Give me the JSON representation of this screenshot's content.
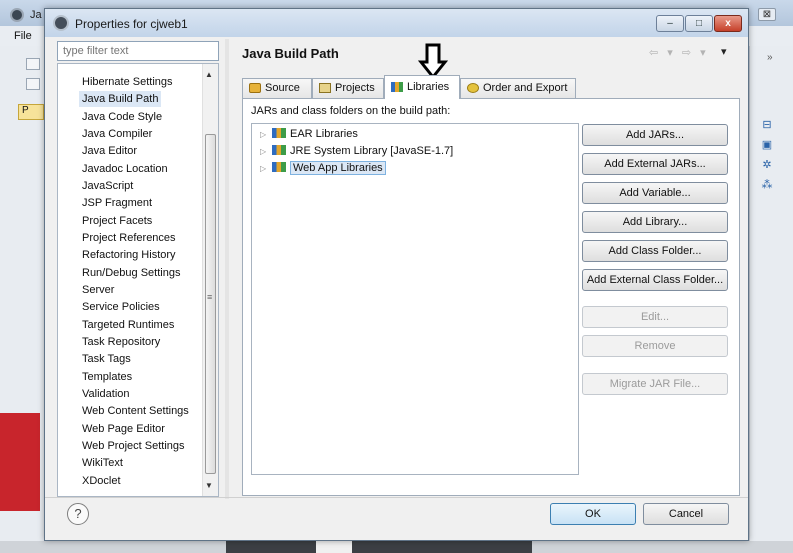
{
  "background": {
    "title_fragment": "Ja",
    "menu_file": "File",
    "package_explorer_tab": "P",
    "close_glyph": "⊠",
    "chevron": "»"
  },
  "dialog": {
    "title": "Properties for cjweb1",
    "filter_placeholder": "type filter text",
    "categories": [
      "Hibernate Settings",
      "Java Build Path",
      "Java Code Style",
      "Java Compiler",
      "Java Editor",
      "Javadoc Location",
      "JavaScript",
      "JSP Fragment",
      "Project Facets",
      "Project References",
      "Refactoring History",
      "Run/Debug Settings",
      "Server",
      "Service Policies",
      "Targeted Runtimes",
      "Task Repository",
      "Task Tags",
      "Templates",
      "Validation",
      "Web Content Settings",
      "Web Page Editor",
      "Web Project Settings",
      "WikiText",
      "XDoclet"
    ],
    "selected_category": "Java Build Path",
    "page_title": "Java Build Path",
    "nav": {
      "arrows": "⇦ ▾ ⇨ ▾",
      "menu": "▾"
    },
    "tabs": [
      {
        "label": "Source",
        "icon": "source-folder-icon"
      },
      {
        "label": "Projects",
        "icon": "projects-icon"
      },
      {
        "label": "Libraries",
        "icon": "libraries-icon",
        "active": true
      },
      {
        "label": "Order and Export",
        "icon": "order-export-icon"
      }
    ],
    "panel_label": "JARs and class folders on the build path:",
    "libraries": [
      {
        "label": "EAR Libraries",
        "selected": false
      },
      {
        "label": "JRE System Library [JavaSE-1.7]",
        "selected": false
      },
      {
        "label": "Web App Libraries",
        "selected": true
      }
    ],
    "buttons": [
      {
        "label": "Add JARs...",
        "enabled": true
      },
      {
        "label": "Add External JARs...",
        "enabled": true
      },
      {
        "label": "Add Variable...",
        "enabled": true
      },
      {
        "label": "Add Library...",
        "enabled": true
      },
      {
        "label": "Add Class Folder...",
        "enabled": true
      },
      {
        "label": "Add External Class Folder...",
        "enabled": true
      },
      {
        "label": "Edit...",
        "enabled": false
      },
      {
        "label": "Remove",
        "enabled": false
      },
      {
        "label": "Migrate JAR File...",
        "enabled": false
      }
    ],
    "footer": {
      "help": "?",
      "ok": "OK",
      "cancel": "Cancel"
    },
    "window_controls": {
      "minimize": "–",
      "maximize": "□",
      "close": "x"
    }
  }
}
